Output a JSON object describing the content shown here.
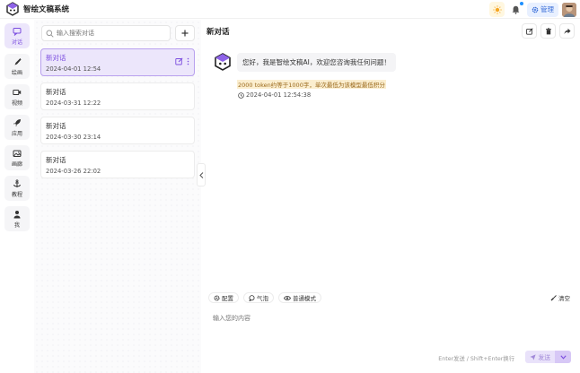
{
  "header": {
    "title": "智绘文稿系统",
    "manage_label": "管理"
  },
  "nav": {
    "items": [
      {
        "label": "对话"
      },
      {
        "label": "绘画"
      },
      {
        "label": "视频"
      },
      {
        "label": "应用"
      },
      {
        "label": "画廊"
      },
      {
        "label": "教程"
      },
      {
        "label": "我"
      }
    ]
  },
  "sidebar": {
    "search_placeholder": "输入搜索对话",
    "conversations": [
      {
        "title": "新对话",
        "time": "2024-04-01 12:54"
      },
      {
        "title": "新对话",
        "time": "2024-03-31 12:22"
      },
      {
        "title": "新对话",
        "time": "2024-03-30 23:14"
      },
      {
        "title": "新对话",
        "time": "2024-03-26 22:02"
      }
    ]
  },
  "chat": {
    "title": "新对话",
    "message": "您好，我是智绘文稿AI，欢迎您咨询我任何问题！",
    "token_note": "2000 token约等于1000字，单次最低为该模型最低积分",
    "message_time": "2024-04-01 12:54:38",
    "tools": {
      "config": "配置",
      "bubble": "气泡",
      "mode": "普通模式",
      "clear": "清空"
    },
    "input_placeholder": "输入您的内容",
    "input_hint": "Enter发送 / Shift+Enter换行",
    "send_label": "发送"
  },
  "colors": {
    "accent": "#7b4ddf",
    "accent_bg": "#ece6fb",
    "manage_text": "#3b6fd8"
  }
}
